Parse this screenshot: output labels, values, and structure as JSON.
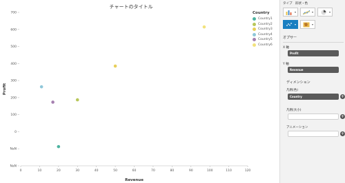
{
  "chart_data": {
    "type": "scatter",
    "title": "チャートのタイトル",
    "xlabel": "Revenue",
    "ylabel": "Profit",
    "xlim": [
      0,
      120
    ],
    "ylim": [
      -300,
      700
    ],
    "x_ticks": [
      "0",
      "10",
      "20",
      "30",
      "40",
      "50",
      "60",
      "70",
      "80",
      "90",
      "100",
      "110",
      "120"
    ],
    "y_ticks": [
      "NaN",
      "NaN",
      "0",
      "100",
      "200",
      "300",
      "400",
      "500",
      "600",
      "700"
    ],
    "legend_title": "Country",
    "legend_position": "top-right",
    "grid": false,
    "series": [
      {
        "name": "Country1",
        "color": "#4db3a0",
        "points": [
          [
            20,
            -175
          ]
        ]
      },
      {
        "name": "Country2",
        "color": "#b8c75a",
        "points": [
          [
            30,
            130
          ]
        ]
      },
      {
        "name": "Country3",
        "color": "#e8cf5a",
        "points": [
          [
            50,
            350
          ]
        ]
      },
      {
        "name": "Country4",
        "color": "#8fc7d9",
        "points": [
          [
            11,
            215
          ]
        ]
      },
      {
        "name": "Country5",
        "color": "#a57fb0",
        "points": [
          [
            17,
            115
          ]
        ]
      },
      {
        "name": "Country6",
        "color": "#f2e27d",
        "points": [
          [
            97,
            605
          ]
        ]
      }
    ]
  },
  "panel": {
    "header": "タイプ　形状・色",
    "tab": "オプサー",
    "x_axis_label": "X 軸",
    "x_axis_value": "Profit",
    "y_axis_label": "Y 軸",
    "y_axis_value": "Revenue",
    "dimension_label": "ディメンション",
    "color_label": "凡例(色)",
    "color_value": "Country",
    "size_label": "凡例(大小)",
    "animation_label": "アニメーション",
    "plus_symbol": "+"
  }
}
